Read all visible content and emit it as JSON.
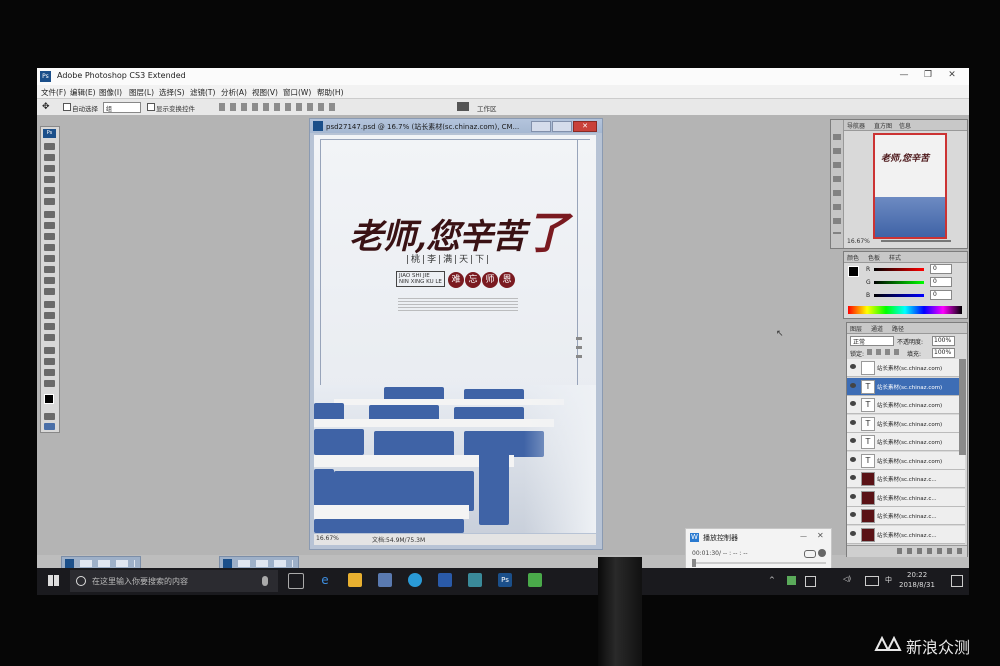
{
  "window": {
    "title": "Adobe Photoshop CS3 Extended",
    "controls": [
      "—",
      "❐",
      "✕"
    ]
  },
  "menu": [
    "文件(F)",
    "编辑(E)",
    "图像(I)",
    "图层(L)",
    "选择(S)",
    "滤镜(T)",
    "分析(A)",
    "视图(V)",
    "窗口(W)",
    "帮助(H)"
  ],
  "options": {
    "auto_select": "自动选择",
    "layer_value": "组",
    "show_transform": "显示变换控件",
    "workspace": "工作区"
  },
  "document": {
    "title": "psd27147.psd @ 16.7% (站长素材(sc.chinaz.com), CM...",
    "zoom": "16.67%",
    "doc_size": "文档:54.9M/75.3M",
    "poster": {
      "headline_main": "老师,您辛苦",
      "headline_end": "了",
      "tagline": "|桃|李|满|天|下|",
      "pinyin_1": "JIAO SHI JIE",
      "pinyin_2": "NIN XING KU LE",
      "seals": [
        "难",
        "忘",
        "师",
        "恩"
      ]
    }
  },
  "navigator": {
    "tabs": [
      "导航器",
      "直方图",
      "信息"
    ],
    "zoom": "16.67%"
  },
  "color": {
    "tabs": [
      "颜色",
      "色板",
      "样式"
    ],
    "labels": [
      "R",
      "G",
      "B"
    ],
    "values": [
      "0",
      "0",
      "0"
    ]
  },
  "layers": {
    "tabs": [
      "图层",
      "通道",
      "路径"
    ],
    "blend": "正常",
    "opacity_label": "不透明度:",
    "opacity": "100%",
    "lock_label": "锁定:",
    "fill_label": "填充:",
    "fill": "100%",
    "items": [
      {
        "name": "站长素材(sc.chinaz.com)",
        "thumb": "",
        "selected": false,
        "mask": false
      },
      {
        "name": "站长素材(sc.chinaz.com)",
        "thumb": "T",
        "selected": true,
        "mask": false
      },
      {
        "name": "站长素材(sc.chinaz.com)",
        "thumb": "T",
        "selected": false,
        "mask": false
      },
      {
        "name": "站长素材(sc.chinaz.com)",
        "thumb": "T",
        "selected": false,
        "mask": false
      },
      {
        "name": "站长素材(sc.chinaz.com)",
        "thumb": "T",
        "selected": false,
        "mask": false
      },
      {
        "name": "站长素材(sc.chinaz.com)",
        "thumb": "T",
        "selected": false,
        "mask": false
      },
      {
        "name": "站长素材(sc.chinaz.c...",
        "thumb": "",
        "selected": false,
        "mask": true
      },
      {
        "name": "站长素材(sc.chinaz.c...",
        "thumb": "",
        "selected": false,
        "mask": true
      },
      {
        "name": "站长素材(sc.chinaz.c...",
        "thumb": "",
        "selected": false,
        "mask": true
      },
      {
        "name": "站长素材(sc.chinaz.c...",
        "thumb": "",
        "selected": false,
        "mask": true
      }
    ]
  },
  "player": {
    "title": "播放控制器",
    "time": "00:01:30/ -- : -- : --",
    "close": "✕"
  },
  "taskbar": {
    "search_placeholder": "在这里输入你要搜索的内容",
    "time": "20:22",
    "date": "2018/8/31",
    "ime": "中"
  },
  "watermark": "新浪众测"
}
